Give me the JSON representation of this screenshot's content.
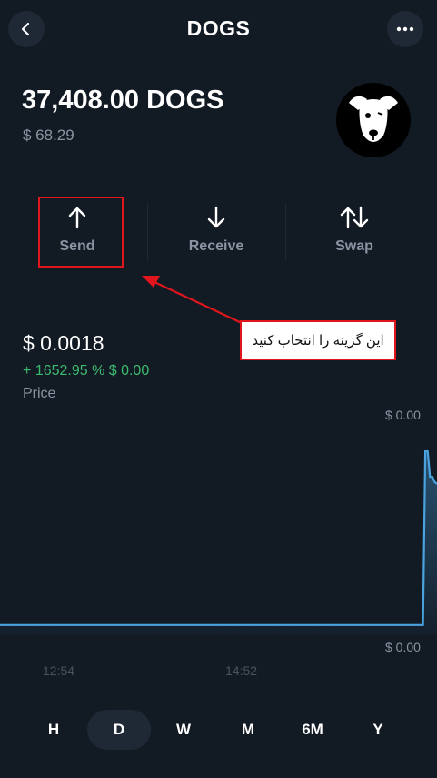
{
  "header": {
    "title": "DOGS",
    "back_icon": "chevron-left-icon",
    "more_icon": "more-horizontal-icon"
  },
  "balance": {
    "amount": "37,408.00 DOGS",
    "fiat": "$ 68.29"
  },
  "actions": [
    {
      "label": "Send",
      "icon": "arrow-up-icon"
    },
    {
      "label": "Receive",
      "icon": "arrow-down-icon"
    },
    {
      "label": "Swap",
      "icon": "swap-icon"
    }
  ],
  "annotation": {
    "text": "این گزینه را انتخاب کنید",
    "color": "#e0161c"
  },
  "price": {
    "value": "$ 0.0018",
    "change": "+ 1652.95 % $ 0.00",
    "label": "Price"
  },
  "chart_data": {
    "type": "area",
    "y_ticks": [
      "$ 0.00",
      "$ 0.00"
    ],
    "x_ticks": [
      "12:54",
      "14:52"
    ],
    "values": [
      0.0001,
      0.0001,
      0.0001,
      0.0001,
      0.0001,
      0.0001,
      0.0001,
      0.0001,
      0.0001,
      0.0001,
      0.0001,
      0.0001,
      0.0001,
      0.0001,
      0.0001,
      0.0001,
      0.0001,
      0.0001,
      0.0001,
      0.0001,
      0.0001,
      0.0001,
      0.0001,
      0.0001,
      0.0001,
      0.0001,
      0.0001,
      0.0001,
      0.0001,
      0.0001,
      0.0001,
      0.0001,
      0.0001,
      0.0001,
      0.0001,
      0.0001,
      0.0001,
      0.0001,
      0.0001,
      0.0001,
      0.0001,
      0.0001,
      0.0001,
      0.0001,
      0.0001,
      0.0001,
      0.0001,
      0.0001,
      0.0001,
      0.0001,
      0.0001,
      0.0001,
      0.0001,
      0.0001,
      0.0001,
      0.0001,
      0.0001,
      0.0001,
      0.0001,
      0.0001,
      0.0001,
      0.0001,
      0.0001,
      0.0001,
      0.0001,
      0.0001,
      0.0001,
      0.0001,
      0.0001,
      0.0001,
      0.0001,
      0.0001,
      0.0001,
      0.0001,
      0.0001,
      0.0001,
      0.0001,
      0.0001,
      0.0001,
      0.0001,
      0.0001,
      0.0001,
      0.0001,
      0.0001,
      0.0001,
      0.0001,
      0.0001,
      0.0001,
      0.0001,
      0.0001,
      0.0001,
      0.0001,
      0.0001,
      0.0001,
      0.0001,
      0.0001,
      0.0001,
      0.0001,
      0.0001,
      0.0001,
      0.0001,
      0.0001,
      0.0001,
      0.0001,
      0.0001,
      0.0001,
      0.0001,
      0.0001,
      0.0001,
      0.0001,
      0.0001,
      0.0001,
      0.0001,
      0.0001,
      0.0001,
      0.0001,
      0.0001,
      0.0001,
      0.0001,
      0.0001,
      0.0001,
      0.0001,
      0.0001,
      0.0001,
      0.0001,
      0.0001,
      0.0001,
      0.0001,
      0.0001,
      0.0001,
      0.0001,
      0.0001,
      0.0001,
      0.0001,
      0.0001,
      0.0001,
      0.0001,
      0.0001,
      0.0001,
      0.0001,
      0.0001,
      0.0001,
      0.0001,
      0.0001,
      0.0001,
      0.0001,
      0.0001,
      0.0001,
      0.0001,
      0.0001,
      0.0001,
      0.0001,
      0.0001,
      0.0001,
      0.0001,
      0.0001,
      0.0001,
      0.0001,
      0.0001,
      0.0001,
      0.0001,
      0.0001,
      0.0001,
      0.0001,
      0.0001,
      0.0001,
      0.0001,
      0.0001,
      0.0001,
      0.0001,
      0.0001,
      0.0001,
      0.0001,
      0.0001,
      0.0001,
      0.0001,
      0.0001,
      0.0001,
      0.0001,
      0.0001,
      0.0001,
      0.0001,
      0.0018,
      0.0018,
      0.00155,
      0.00155,
      0.0015,
      0.00148
    ],
    "line_color": "#4aa3df",
    "grid": false
  },
  "periods": [
    {
      "label": "H",
      "active": false
    },
    {
      "label": "D",
      "active": true
    },
    {
      "label": "W",
      "active": false
    },
    {
      "label": "M",
      "active": false
    },
    {
      "label": "6M",
      "active": false
    },
    {
      "label": "Y",
      "active": false
    }
  ]
}
